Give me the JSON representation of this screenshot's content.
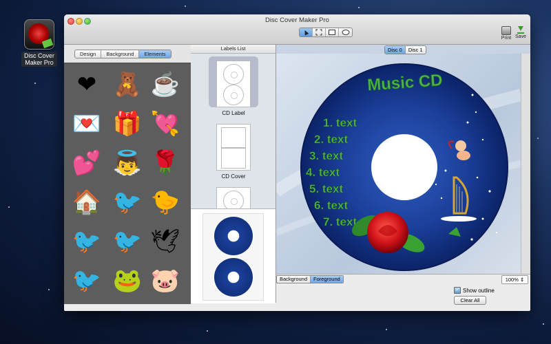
{
  "desktop": {
    "icon_label_line1": "Disc Cover",
    "icon_label_line2": "Maker Pro"
  },
  "window": {
    "title": "Disc Cover Maker Pro"
  },
  "toolbar": {
    "print_label": "Print",
    "save_label": "Save"
  },
  "left_tabs": [
    "Design",
    "Background",
    "Elements"
  ],
  "left_tabs_selected": "Elements",
  "elements": [
    {
      "icon": "heart-icon",
      "glyph": "❤"
    },
    {
      "icon": "teddy-bear-icon",
      "glyph": "🧸"
    },
    {
      "icon": "coffee-cup-icon",
      "glyph": "☕"
    },
    {
      "icon": "love-note-icon",
      "glyph": "💌"
    },
    {
      "icon": "gift-icon",
      "glyph": "🎁"
    },
    {
      "icon": "heart-arrow-icon",
      "glyph": "💘"
    },
    {
      "icon": "winged-heart-icon",
      "glyph": "💕"
    },
    {
      "icon": "cupid-icon",
      "glyph": "👼"
    },
    {
      "icon": "rose-icon",
      "glyph": "🌹"
    },
    {
      "icon": "house-icon",
      "glyph": "🏠"
    },
    {
      "icon": "red-bird-icon",
      "glyph": "🐦"
    },
    {
      "icon": "yellow-bird-icon",
      "glyph": "🐤"
    },
    {
      "icon": "black-bird-icon",
      "glyph": "🐦"
    },
    {
      "icon": "robin-icon",
      "glyph": "🐦"
    },
    {
      "icon": "flying-bird-icon",
      "glyph": "🕊"
    },
    {
      "icon": "blue-bird-icon",
      "glyph": "🐦"
    },
    {
      "icon": "green-bird-icon",
      "glyph": "🐸"
    },
    {
      "icon": "pig-icon",
      "glyph": "🐷"
    }
  ],
  "labels_list": {
    "header": "Labels List",
    "items": [
      {
        "name": "CD Label"
      },
      {
        "name": "CD Cover"
      },
      {
        "name": ""
      }
    ]
  },
  "disc_tabs": [
    "Disc 0",
    "Disc 1"
  ],
  "disc_tabs_selected": "Disc 0",
  "disc": {
    "title": "Music CD",
    "tracks": [
      "1. text",
      "2. text",
      "3. text",
      "4. text",
      "5. text",
      "6. text",
      "7. text"
    ]
  },
  "bottom": {
    "layer_tabs": [
      "Background",
      "Foreground"
    ],
    "layer_selected": "Foreground",
    "zoom": "100%",
    "show_outline_label": "Show outline",
    "show_outline_checked": true,
    "clear_all_label": "Clear All"
  },
  "colors": {
    "accent": "#6ea6e6",
    "disc_blue": "#1b3f9a",
    "title_green": "#4fb84a"
  }
}
